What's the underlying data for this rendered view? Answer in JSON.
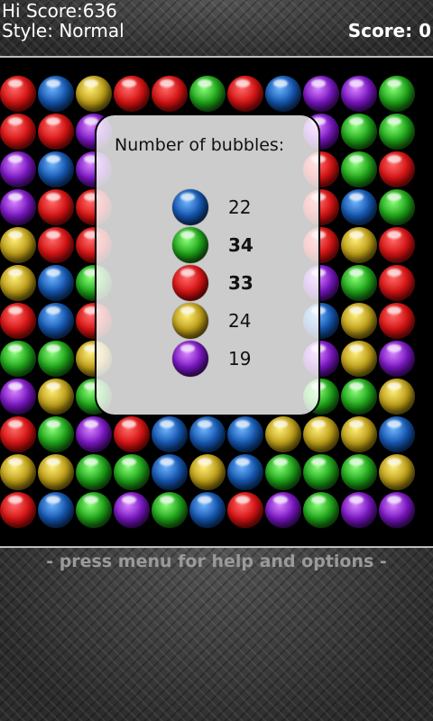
{
  "header": {
    "hi_score": "Hi Score:636",
    "style": "Style: Normal",
    "score": "Score: 0"
  },
  "board": {
    "rows": [
      [
        "red",
        "blue",
        "yellow",
        "red",
        "red",
        "green",
        "red",
        "blue",
        "purple",
        "purple",
        "green"
      ],
      [
        "red",
        "red",
        "purple",
        "",
        "",
        "",
        "",
        "",
        "purple",
        "green",
        "green"
      ],
      [
        "purple",
        "blue",
        "purple",
        "",
        "",
        "",
        "",
        "",
        "red",
        "green",
        "red"
      ],
      [
        "purple",
        "red",
        "red",
        "",
        "",
        "",
        "",
        "",
        "red",
        "blue",
        "green"
      ],
      [
        "yellow",
        "red",
        "red",
        "",
        "",
        "",
        "",
        "",
        "red",
        "yellow",
        "red"
      ],
      [
        "yellow",
        "blue",
        "green",
        "",
        "",
        "",
        "",
        "",
        "purple",
        "green",
        "red"
      ],
      [
        "red",
        "blue",
        "red",
        "",
        "",
        "",
        "",
        "",
        "blue",
        "yellow",
        "red"
      ],
      [
        "green",
        "green",
        "yellow",
        "",
        "",
        "",
        "",
        "",
        "purple",
        "yellow",
        "purple"
      ],
      [
        "purple",
        "yellow",
        "green",
        "",
        "",
        "",
        "",
        "",
        "green",
        "green",
        "yellow"
      ],
      [
        "red",
        "green",
        "purple",
        "red",
        "blue",
        "blue",
        "blue",
        "yellow",
        "yellow",
        "yellow",
        "blue"
      ],
      [
        "yellow",
        "yellow",
        "green",
        "green",
        "blue",
        "yellow",
        "blue",
        "green",
        "green",
        "green",
        "yellow"
      ],
      [
        "red",
        "blue",
        "green",
        "purple",
        "green",
        "blue",
        "red",
        "purple",
        "green",
        "purple",
        "purple"
      ]
    ]
  },
  "dialog": {
    "title": "Number of bubbles:",
    "counts": [
      {
        "color": "blue",
        "value": "22",
        "bold": false
      },
      {
        "color": "green",
        "value": "34",
        "bold": true
      },
      {
        "color": "red",
        "value": "33",
        "bold": true
      },
      {
        "color": "yellow",
        "value": "24",
        "bold": false
      },
      {
        "color": "purple",
        "value": "19",
        "bold": false
      }
    ]
  },
  "footer": {
    "hint": "- press menu for help and options -"
  }
}
